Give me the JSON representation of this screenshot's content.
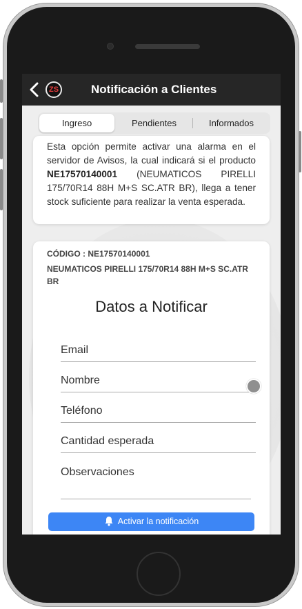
{
  "navbar": {
    "title": "Notificación a Clientes",
    "logo_text": "ZS",
    "back_icon": "chevron-left-icon"
  },
  "tabs": [
    {
      "label": "Ingreso",
      "active": true
    },
    {
      "label": "Pendientes",
      "active": false
    },
    {
      "label": "Informados",
      "active": false
    }
  ],
  "info": {
    "text_before": "Esta opción permite activar una alarma en el servidor de Avisos, la cual indicará si el producto ",
    "product_code": "NE17570140001",
    "text_after": " (NEUMATICOS PIRELLI 175/70R14 88H M+S SC.ATR BR), llega a tener stock suficiente para realizar la venta esperada."
  },
  "form": {
    "code_line": "CÓDIGO : NE17570140001",
    "product_name": "NEUMATICOS PIRELLI 175/70R14 88H M+S SC.ATR BR",
    "title": "Datos a Notificar",
    "fields": {
      "email": "Email",
      "nombre": "Nombre",
      "telefono": "Teléfono",
      "cantidad": "Cantidad esperada",
      "observaciones": "Observaciones"
    },
    "submit_label": "Activar la notificación",
    "submit_icon": "bell-icon"
  },
  "colors": {
    "navbar": "#262626",
    "accent": "#3d86f5",
    "screen_bg": "#eeeeee"
  }
}
